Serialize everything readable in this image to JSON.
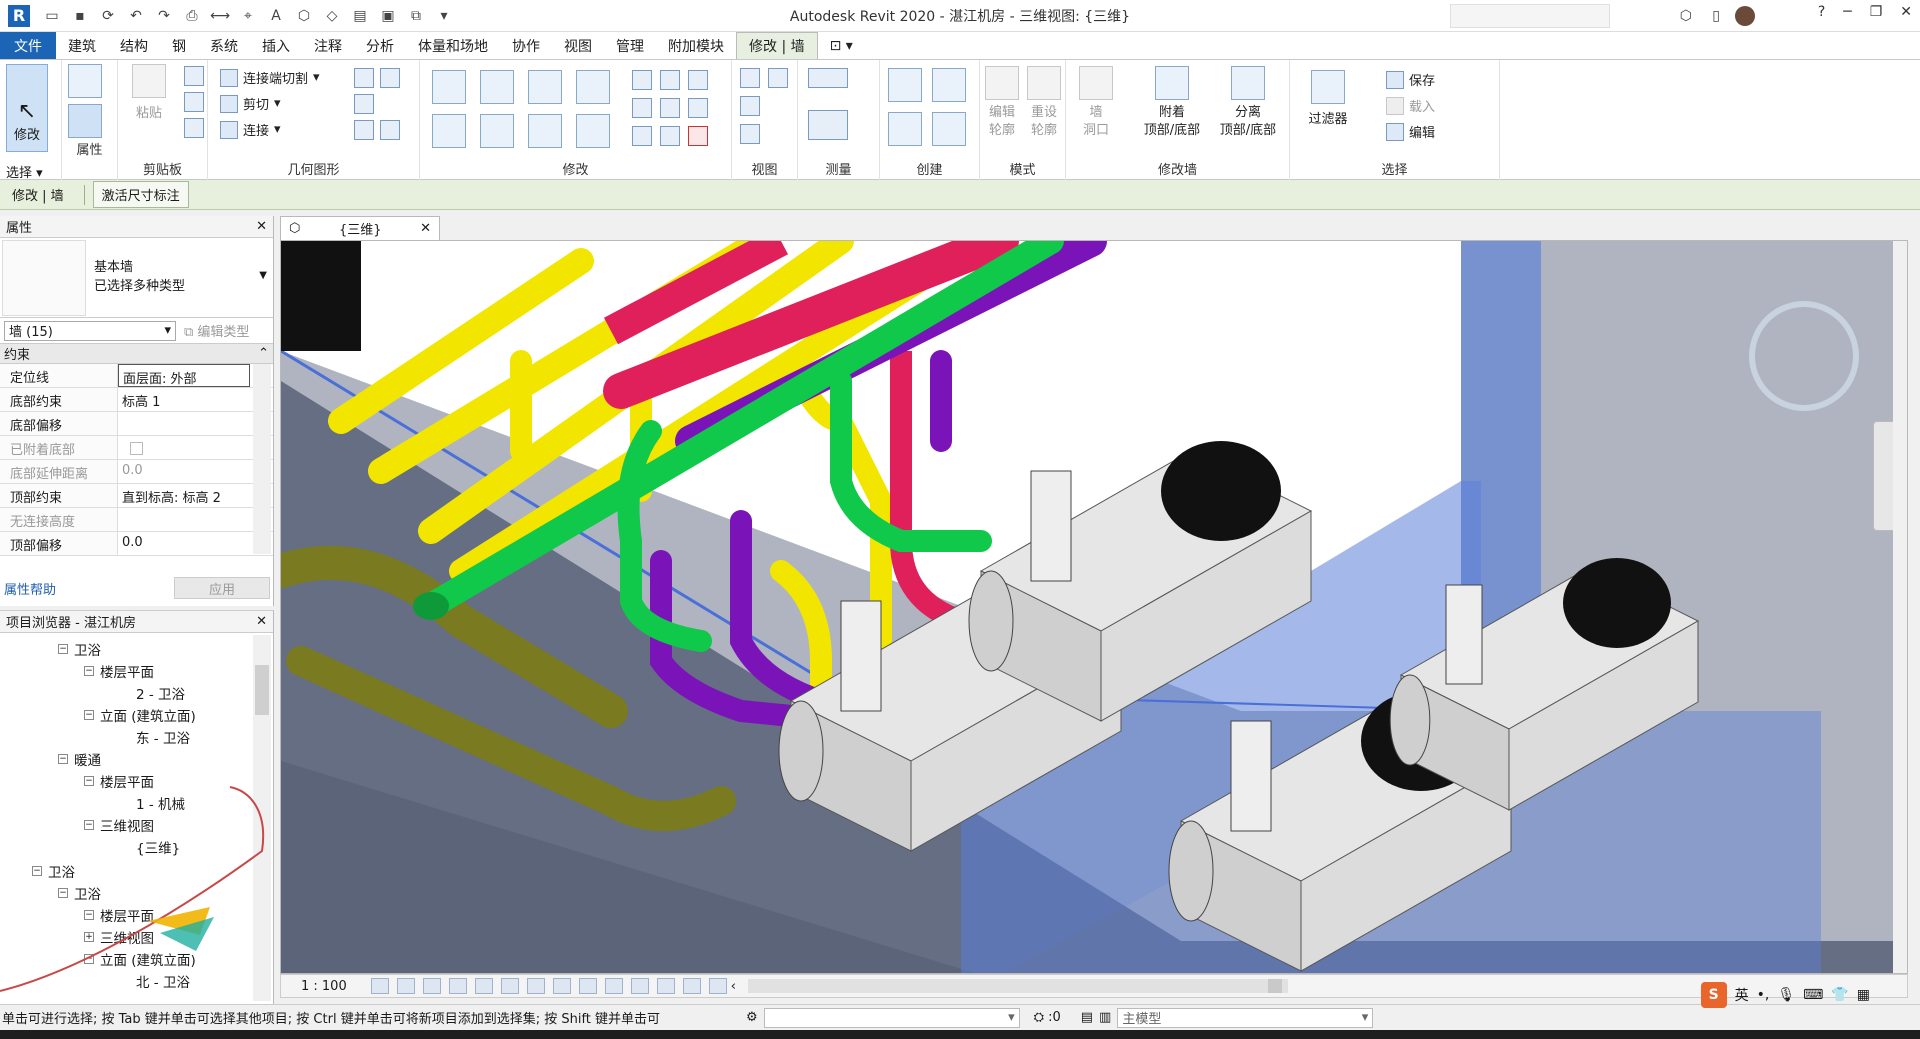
{
  "app": {
    "title": "Autodesk Revit 2020 - 湛江机房 - 三维视图: {三维}",
    "logo": "R"
  },
  "menu": {
    "tabs": [
      "文件",
      "建筑",
      "结构",
      "钢",
      "系统",
      "插入",
      "注释",
      "分析",
      "体量和场地",
      "协作",
      "视图",
      "管理",
      "附加模块",
      "修改 | 墙"
    ]
  },
  "ribbon": {
    "modify_label": "修改",
    "select_label": "选择",
    "properties_label": "属性",
    "clipboard_label": "剪贴板",
    "paste_label": "粘贴",
    "geometry_label": "几何图形",
    "join_cut_label": "连接端切割",
    "cut_label": "剪切",
    "join_label": "连接",
    "modify_group_label": "修改",
    "view_group_label": "视图",
    "measure_group_label": "测量",
    "create_group_label": "创建",
    "mode_group_label": "模式",
    "edit_profile_label": "编辑\n轮廓",
    "reset_profile_label": "重设\n轮廓",
    "wall_opening_label": "墙\n洞口",
    "attach_label": "附着\n顶部/底部",
    "detach_label": "分离\n顶部/底部",
    "modify_wall_group_label": "修改墙",
    "filter_label": "过滤器",
    "save_label": "保存",
    "load_label": "载入",
    "edit_label": "编辑",
    "selection_group_label": "选择"
  },
  "optionsbar": {
    "context": "修改 | 墙",
    "activate_dim": "激活尺寸标注"
  },
  "properties": {
    "header": "属性",
    "type_name_1": "基本墙",
    "type_name_2": "已选择多种类型",
    "instance": "墙 (15)",
    "edit_type": "编辑类型",
    "group": "约束",
    "rows": [
      {
        "key": "定位线",
        "value": "面层面: 外部"
      },
      {
        "key": "底部约束",
        "value": "标高 1"
      },
      {
        "key": "底部偏移",
        "value": ""
      },
      {
        "key": "已附着底部",
        "value": ""
      },
      {
        "key": "底部延伸距离",
        "value": "0.0"
      },
      {
        "key": "顶部约束",
        "value": "直到标高: 标高 2"
      },
      {
        "key": "无连接高度",
        "value": ""
      },
      {
        "key": "顶部偏移",
        "value": "0.0"
      }
    ],
    "help": "属性帮助",
    "apply": "应用"
  },
  "browser": {
    "header": "项目浏览器 - 湛江机房",
    "nodes": [
      "卫浴",
      "楼层平面",
      "2 - 卫浴",
      "立面 (建筑立面)",
      "东 - 卫浴",
      "暖通",
      "楼层平面",
      "1 - 机械",
      "三维视图",
      "{三维}",
      "卫浴",
      "卫浴",
      "楼层平面",
      "三维视图",
      "立面 (建筑立面)",
      "北 - 卫浴"
    ]
  },
  "view": {
    "tab_label": "{三维}",
    "scale": "1 : 100"
  },
  "status": {
    "message": "单击可进行选择; 按 Tab 键并单击可选择其他项目; 按 Ctrl 键并单击可将新项目添加到选择集; 按 Shift 键并单击可",
    "selected_count": ":0",
    "model": "主模型"
  },
  "ime": {
    "logo": "S",
    "lang": "英"
  },
  "pipe_colors": {
    "yellow": "#f2e600",
    "magenta": "#e0205a",
    "purple": "#7b14b8",
    "green": "#10c84a",
    "olive": "#7a7a20",
    "wall_blue": "#5a7fd8"
  }
}
